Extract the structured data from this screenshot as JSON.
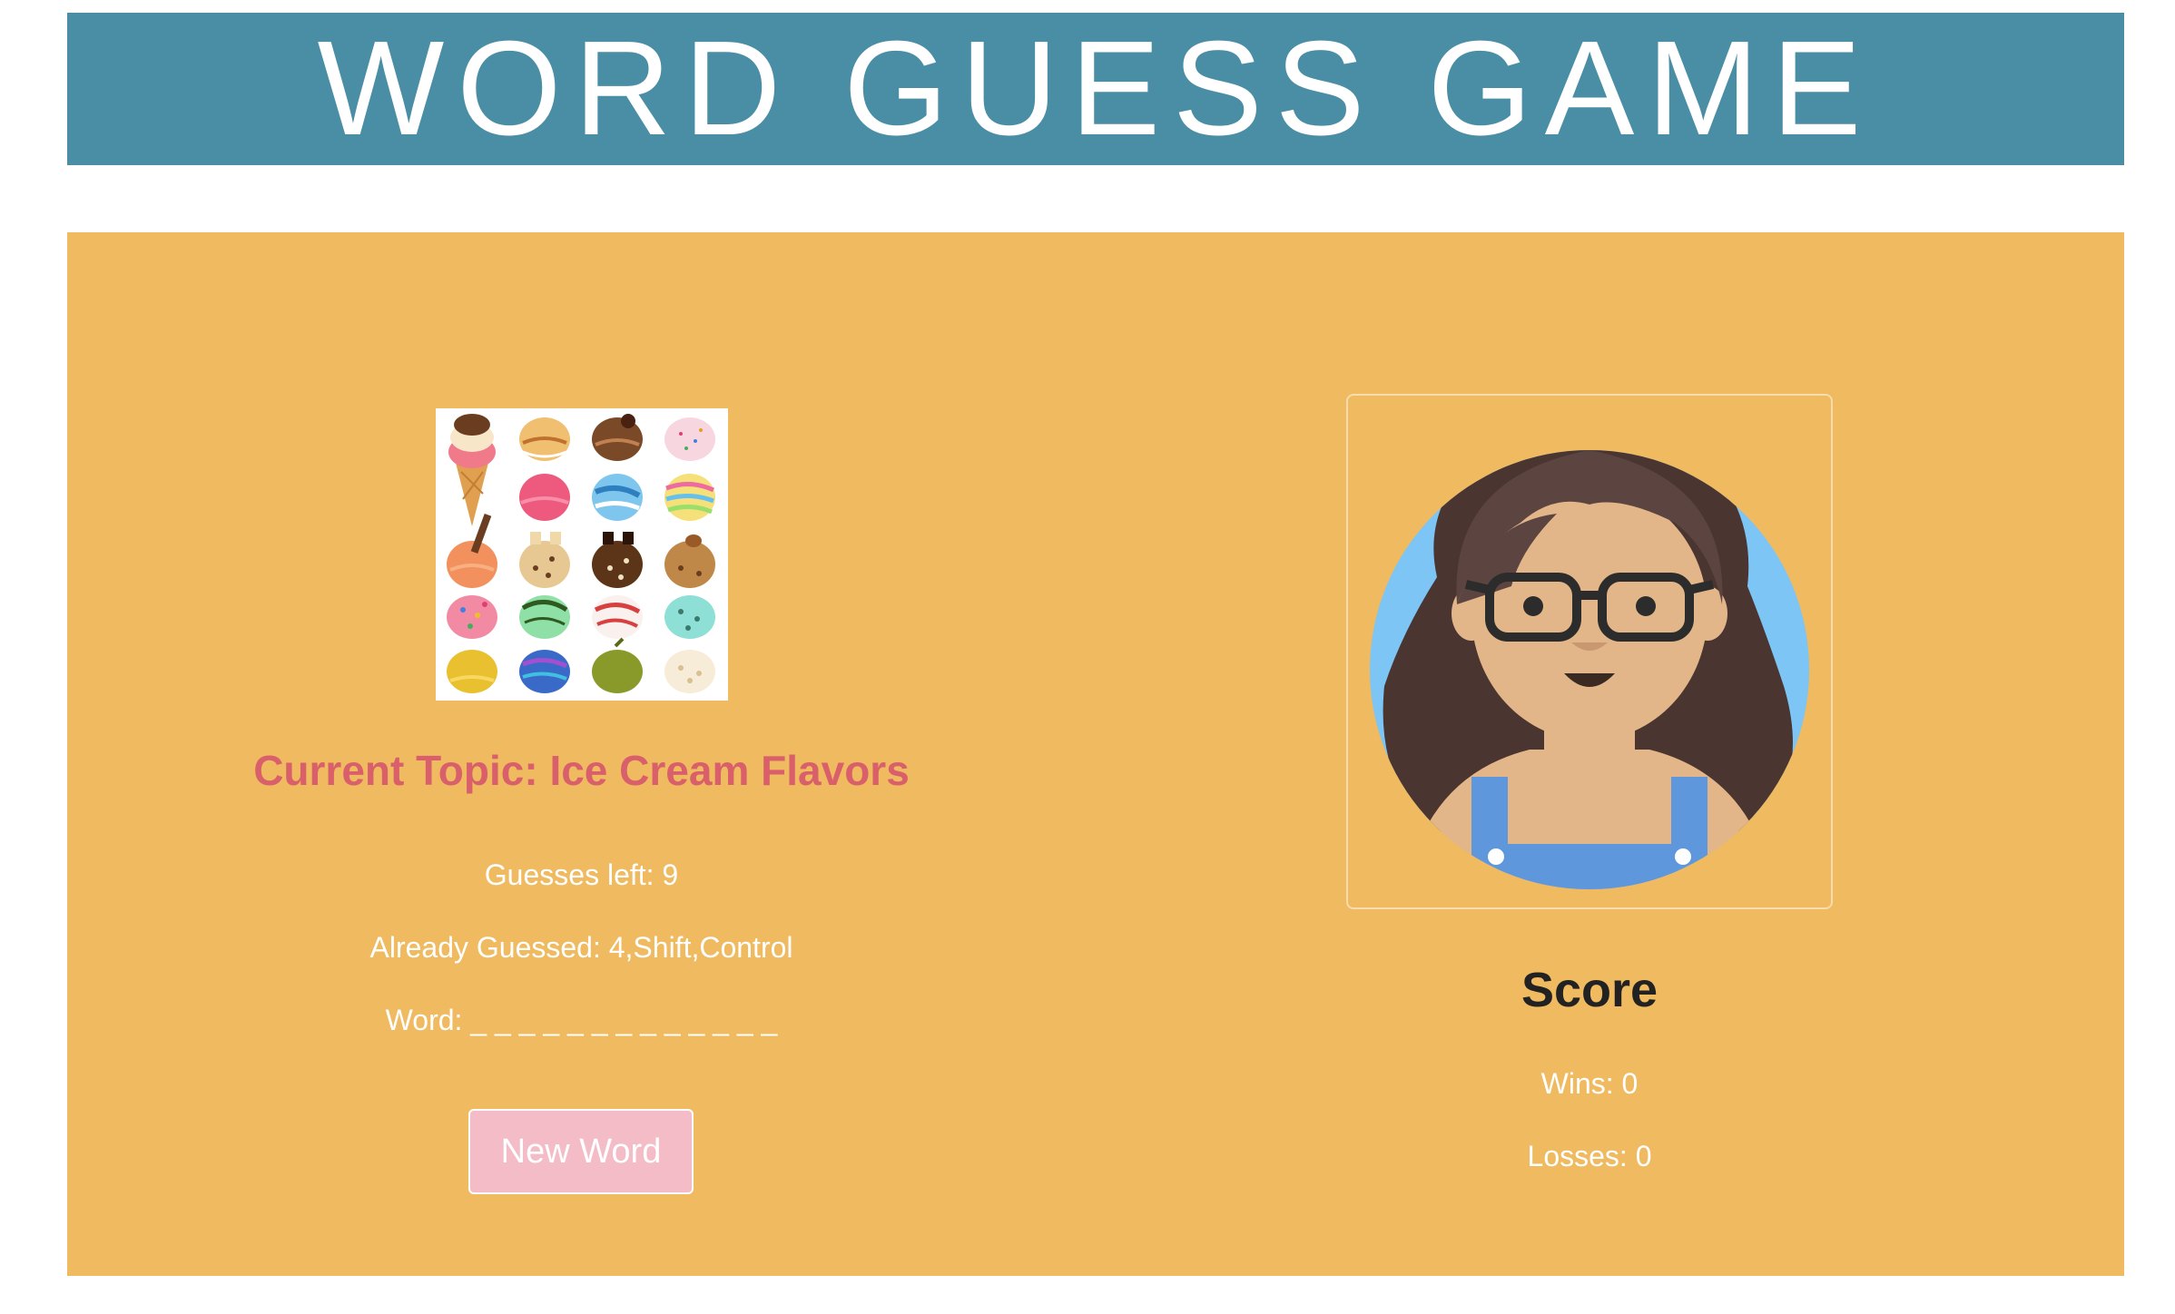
{
  "header": {
    "title": "WORD GUESS GAME"
  },
  "game": {
    "topic_label": "Current Topic: Ice Cream Flavors",
    "guesses_left": "Guesses left: 9",
    "already_guessed": "Already Guessed: 4,Shift,Control",
    "word": "Word: _ _ _ _ _ _ _ _ _ _ _ _ _",
    "new_word_label": "New Word",
    "topic_image_icon": "ice-cream-scoops-grid"
  },
  "score": {
    "heading": "Score",
    "wins": "Wins: 0",
    "losses": "Losses: 0",
    "avatar_icon": "girl-with-glasses-avatar"
  },
  "colors": {
    "header_bg": "#4a8ea6",
    "panel_bg": "#efba60",
    "topic_text": "#d9606b",
    "button_bg": "#f4bcc6",
    "avatar_bg": "#7dc5f5"
  }
}
